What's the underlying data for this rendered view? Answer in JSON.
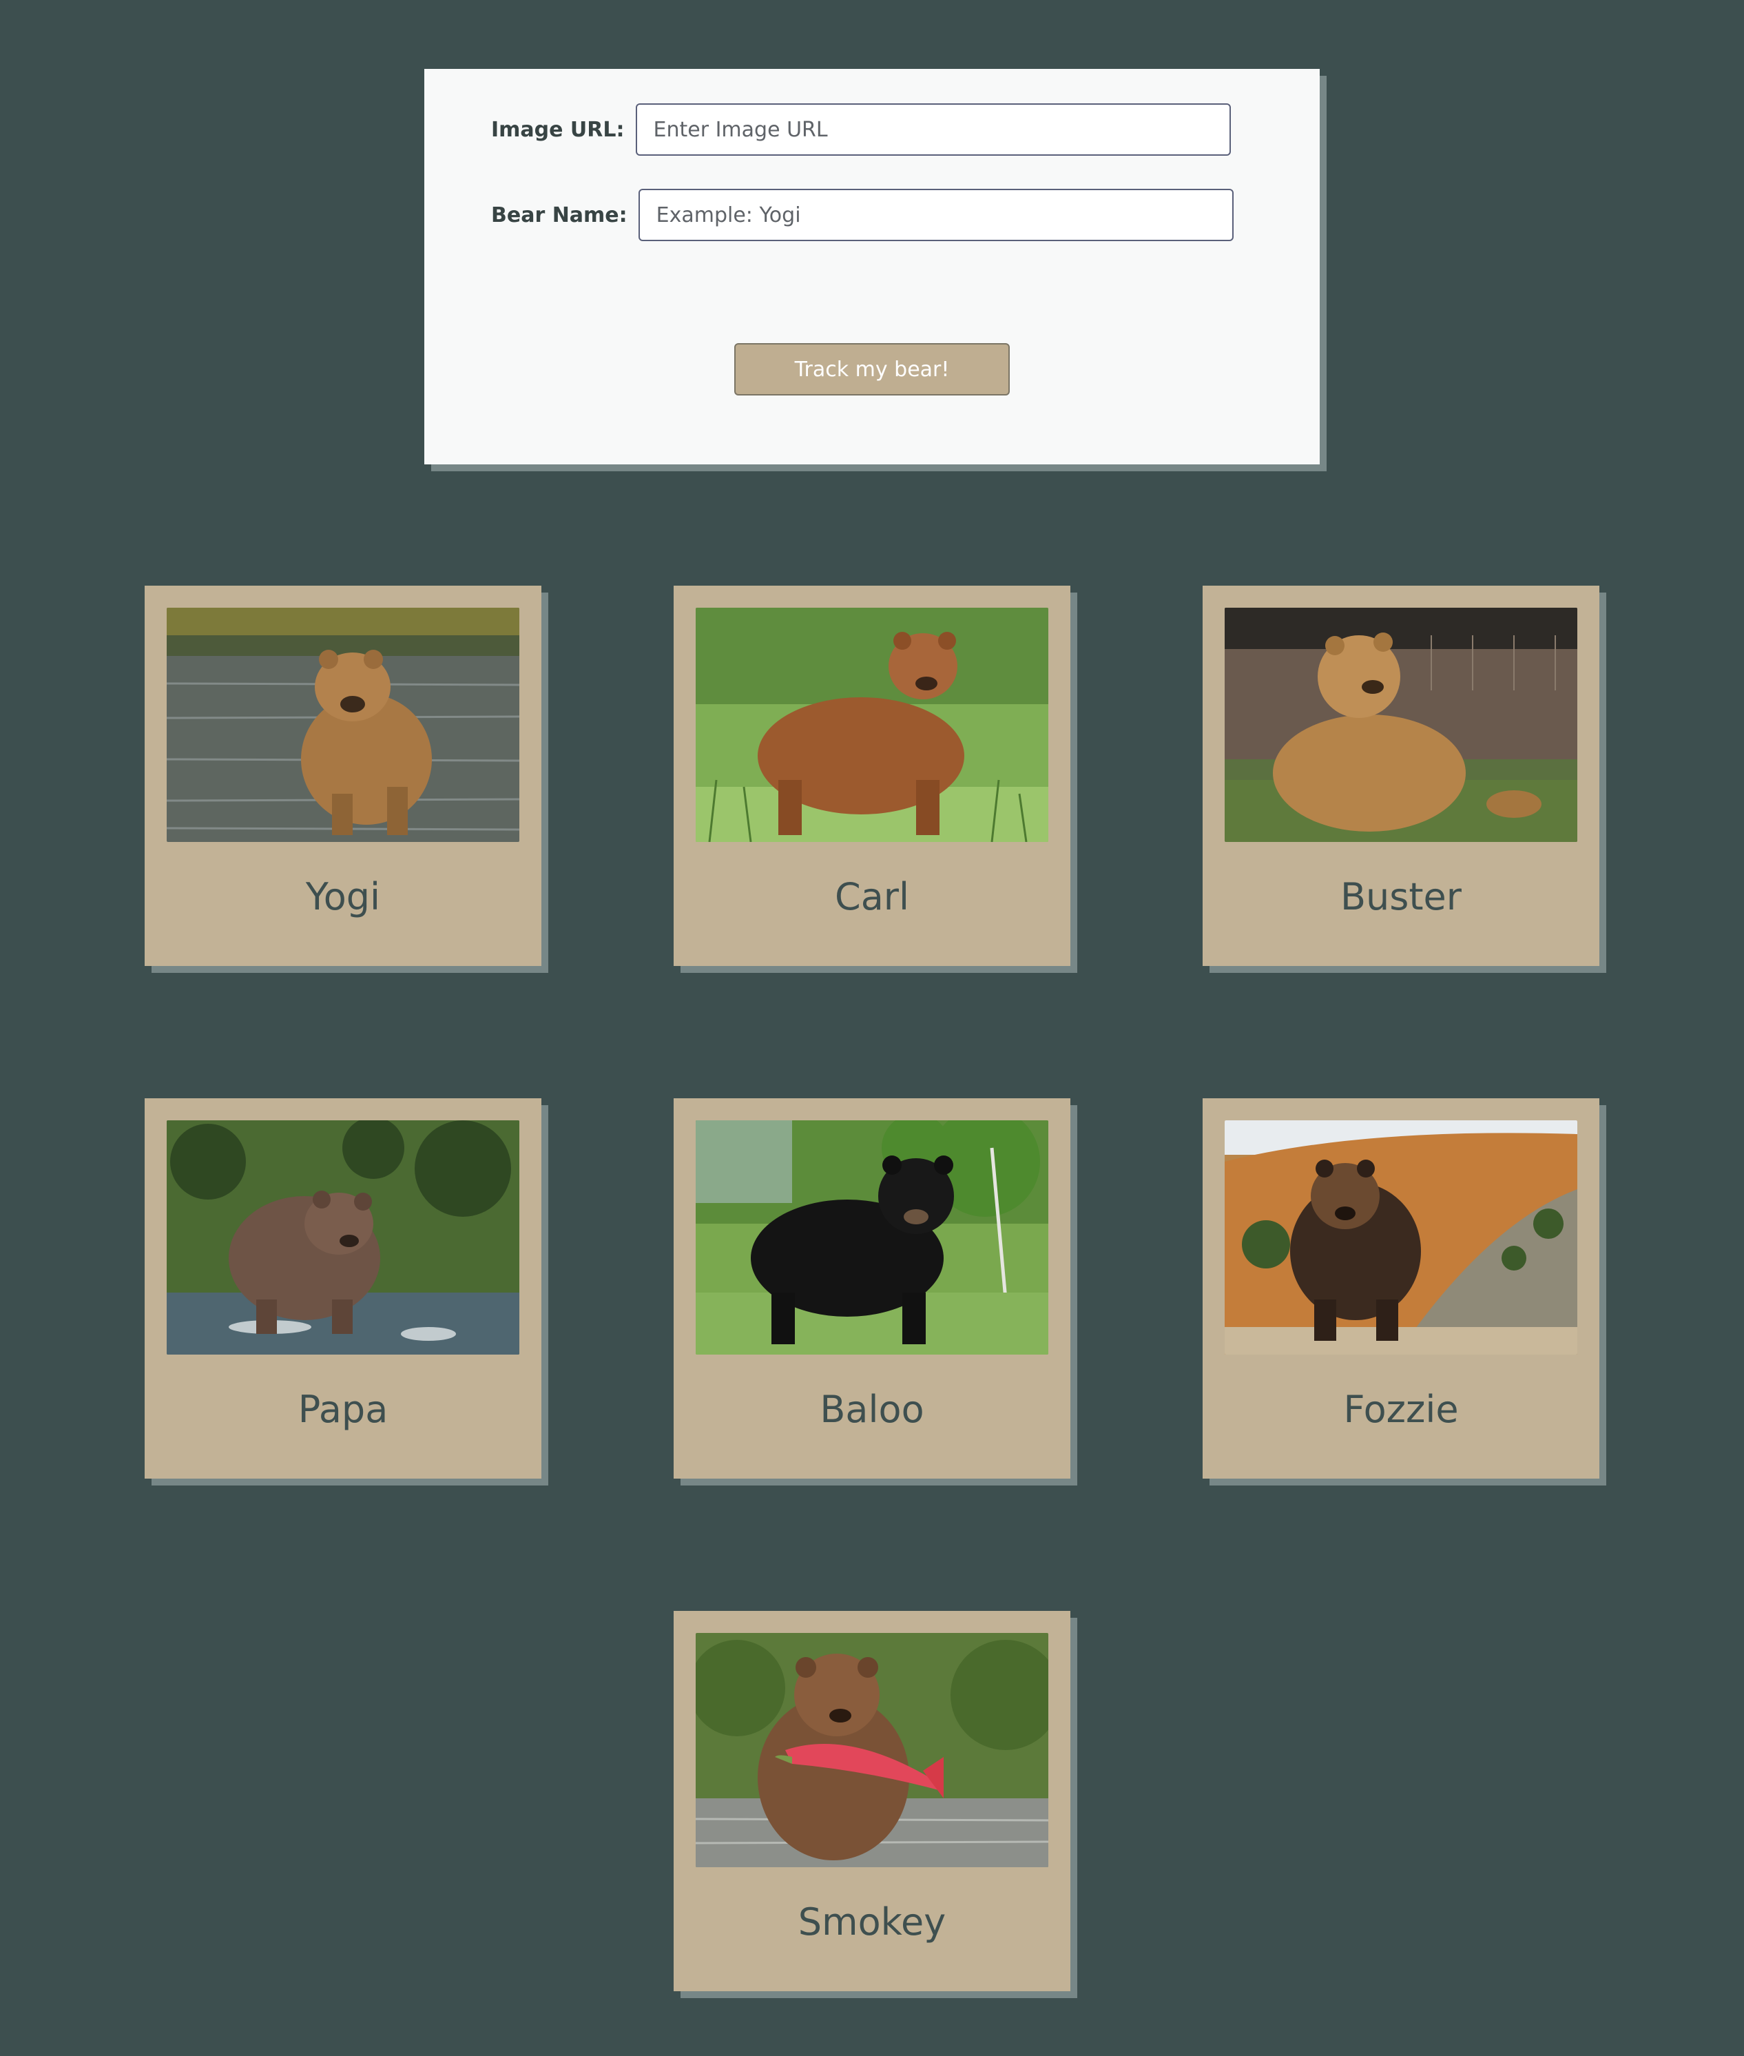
{
  "form": {
    "image_url_label": "Image URL:",
    "image_url_placeholder": "Enter Image URL",
    "image_url_value": "",
    "bear_name_label": "Bear Name:",
    "bear_name_placeholder": "Example: Yogi",
    "bear_name_value": "",
    "submit_label": "Track my bear!"
  },
  "colors": {
    "background": "#3d4f4f",
    "panel": "#f8f9f9",
    "card": "#c2b296",
    "button": "#bfae91",
    "name_text": "#3e4f4f"
  },
  "bears": [
    {
      "name": "Yogi",
      "photo_icon": "brown-bear-in-river-photo"
    },
    {
      "name": "Carl",
      "photo_icon": "brown-bear-in-grass-photo"
    },
    {
      "name": "Buster",
      "photo_icon": "bear-sitting-photo"
    },
    {
      "name": "Papa",
      "photo_icon": "fat-bear-in-stream-photo"
    },
    {
      "name": "Baloo",
      "photo_icon": "black-bear-on-grass-photo"
    },
    {
      "name": "Fozzie",
      "photo_icon": "grizzly-on-hillside-photo"
    },
    {
      "name": "Smokey",
      "photo_icon": "bear-with-salmon-photo"
    }
  ]
}
